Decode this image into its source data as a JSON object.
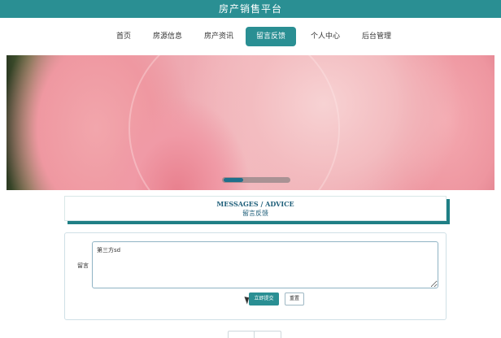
{
  "header": {
    "title": "房产销售平台"
  },
  "nav": {
    "items": [
      {
        "label": "首页",
        "active": false
      },
      {
        "label": "房源信息",
        "active": false
      },
      {
        "label": "房产资讯",
        "active": false
      },
      {
        "label": "留言反馈",
        "active": true
      },
      {
        "label": "个人中心",
        "active": false
      },
      {
        "label": "后台管理",
        "active": false
      }
    ]
  },
  "banner": {
    "slider_progress": 0.3
  },
  "section": {
    "title_en": "MESSAGES / ADVICE",
    "title_zh": "留言反馈"
  },
  "form": {
    "label": "留言",
    "message_value": "第三方sd",
    "submit_label": "立即提交",
    "reset_label": "重置"
  },
  "colors": {
    "accent": "#2a8f93",
    "heading": "#1f5f7a"
  }
}
